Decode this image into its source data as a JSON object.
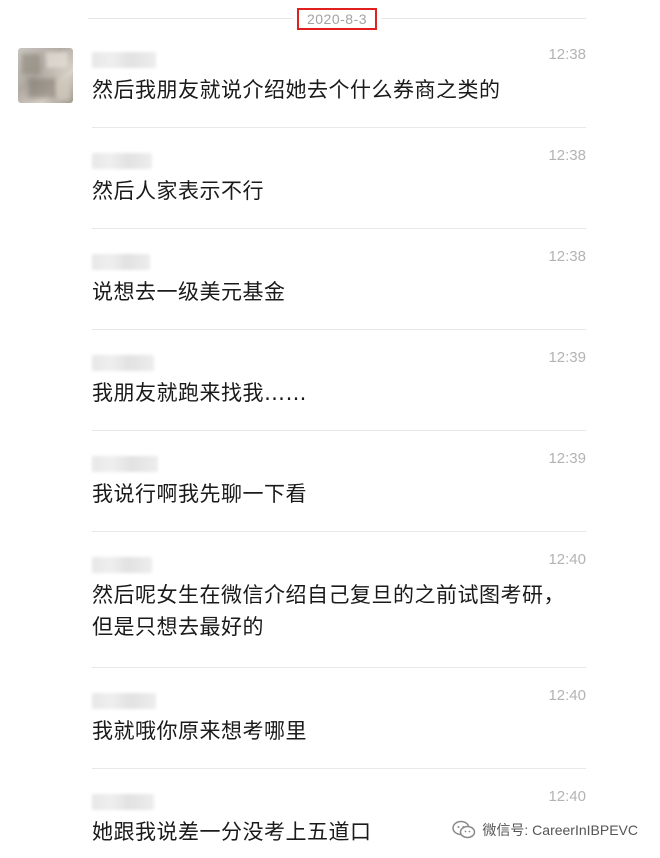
{
  "date": "2020-8-3",
  "messages": [
    {
      "time": "12:38",
      "text": "然后我朋友就说介绍她去个什么券商之类的"
    },
    {
      "time": "12:38",
      "text": "然后人家表示不行"
    },
    {
      "time": "12:38",
      "text": "说想去一级美元基金"
    },
    {
      "time": "12:39",
      "text": "我朋友就跑来找我……"
    },
    {
      "time": "12:39",
      "text": "我说行啊我先聊一下看"
    },
    {
      "time": "12:40",
      "text": "然后呢女生在微信介绍自己复旦的之前试图考研，但是只想去最好的"
    },
    {
      "time": "12:40",
      "text": "我就哦你原来想考哪里"
    },
    {
      "time": "12:40",
      "text": "她跟我说差一分没考上五道口"
    }
  ],
  "watermark": {
    "text": "微信号: CareerInIBPEVC",
    "icon": "wechat-icon"
  },
  "colors": {
    "date_highlight": "#e02020",
    "timestamp": "#b3b3b3",
    "message_text": "#1a1a1a"
  }
}
